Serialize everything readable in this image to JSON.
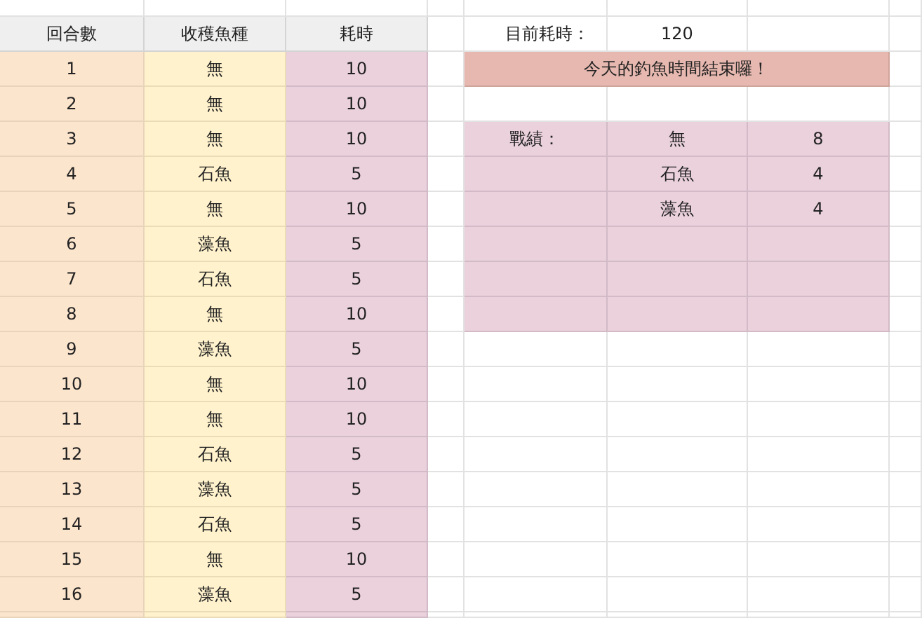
{
  "table": {
    "columns": [
      "回合數",
      "收穫魚種",
      "耗時"
    ],
    "rows": [
      {
        "round": "1",
        "catch": "無",
        "time": "10"
      },
      {
        "round": "2",
        "catch": "無",
        "time": "10"
      },
      {
        "round": "3",
        "catch": "無",
        "time": "10"
      },
      {
        "round": "4",
        "catch": "石魚",
        "time": "5"
      },
      {
        "round": "5",
        "catch": "無",
        "time": "10"
      },
      {
        "round": "6",
        "catch": "藻魚",
        "time": "5"
      },
      {
        "round": "7",
        "catch": "石魚",
        "time": "5"
      },
      {
        "round": "8",
        "catch": "無",
        "time": "10"
      },
      {
        "round": "9",
        "catch": "藻魚",
        "time": "5"
      },
      {
        "round": "10",
        "catch": "無",
        "time": "10"
      },
      {
        "round": "11",
        "catch": "無",
        "time": "10"
      },
      {
        "round": "12",
        "catch": "石魚",
        "time": "5"
      },
      {
        "round": "13",
        "catch": "藻魚",
        "time": "5"
      },
      {
        "round": "14",
        "catch": "石魚",
        "time": "5"
      },
      {
        "round": "15",
        "catch": "無",
        "time": "10"
      },
      {
        "round": "16",
        "catch": "藻魚",
        "time": "5"
      }
    ]
  },
  "summary": {
    "label": "目前耗時：",
    "value": "120",
    "banner": "今天的釣魚時間結束囉！",
    "results_label": "戰績：",
    "results": [
      {
        "fish": "無",
        "count": "8"
      },
      {
        "fish": "石魚",
        "count": "4"
      },
      {
        "fish": "藻魚",
        "count": "4"
      }
    ]
  }
}
